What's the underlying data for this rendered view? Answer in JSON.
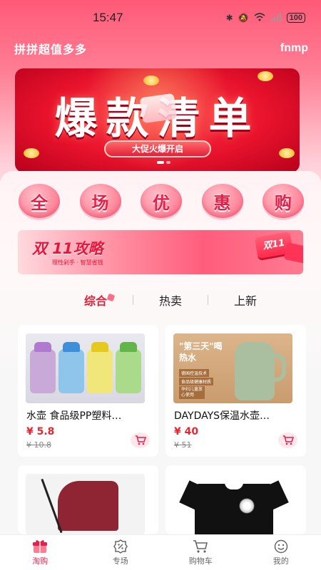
{
  "status_bar": {
    "time": "15:47",
    "battery": "100"
  },
  "header": {
    "app_title": "拼拼超值多多",
    "user_name": "fnmp"
  },
  "banner": {
    "title": "爆款清单",
    "subtitle": "大促火爆开启"
  },
  "promo_chars": [
    "全",
    "场",
    "优",
    "惠",
    "购"
  ],
  "strategy_banner": {
    "title": "双 11攻略",
    "subtitle": "理性剁手 · 智慧省钱",
    "badge": "双11"
  },
  "tabs": [
    {
      "label": "综合",
      "active": true
    },
    {
      "label": "热卖",
      "active": false
    },
    {
      "label": "上新",
      "active": false
    }
  ],
  "products": [
    {
      "name": "水壶 食品级PP塑料…",
      "price": "¥ 5.8",
      "original_price": "¥ 10.8",
      "image": "kids-water-bottles"
    },
    {
      "name": "DAYDAYS保温水壶…",
      "price": "¥ 40",
      "original_price": "¥ 51",
      "image": "thermos-kettle",
      "image_text": {
        "headline": "\"第三天\"喝热水",
        "tag1": "德国控温技术",
        "tag2": "食品级健康材质",
        "tag3": "孕妇儿童放心使用"
      }
    },
    {
      "name": "",
      "price": "",
      "original_price": "",
      "image": "baby-stroller"
    },
    {
      "name": "",
      "price": "",
      "original_price": "",
      "image": "black-tshirt"
    }
  ],
  "bottom_nav": [
    {
      "label": "淘购",
      "icon": "gift-icon",
      "active": true
    },
    {
      "label": "专场",
      "icon": "discount-icon",
      "active": false
    },
    {
      "label": "购物车",
      "icon": "cart-icon",
      "active": false
    },
    {
      "label": "我的",
      "icon": "profile-icon",
      "active": false
    }
  ],
  "colors": {
    "accent": "#e51f48",
    "price": "#e5262f",
    "header_gradient_top": "#ff5a78"
  }
}
